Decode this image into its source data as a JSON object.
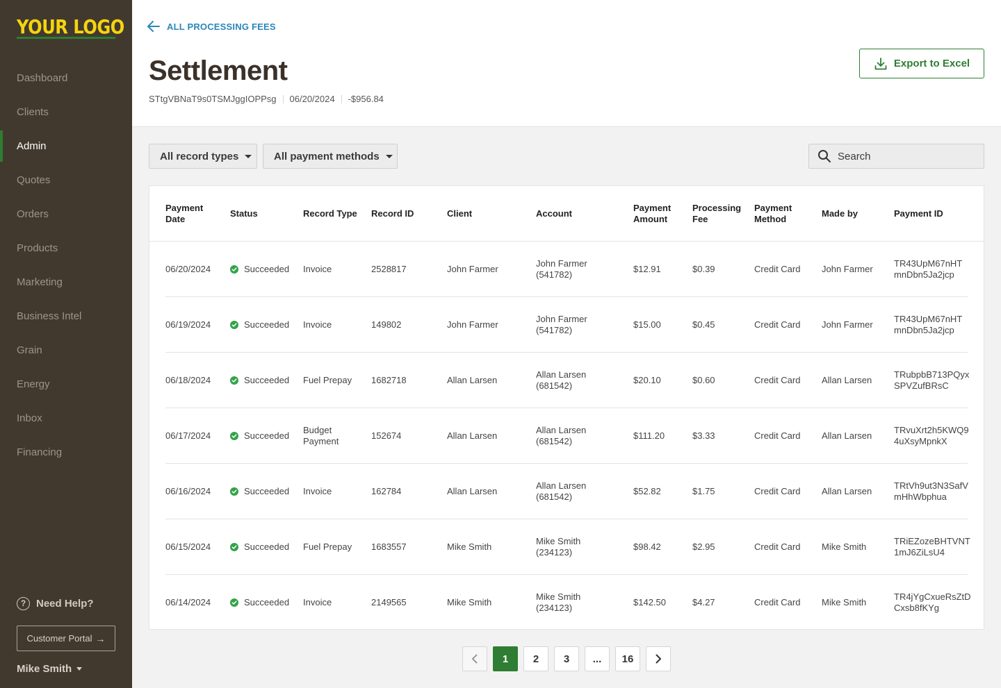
{
  "brand": {
    "logo_text": "YOUR LOGO",
    "accent": "#2e7d32",
    "logo_color": "#f5d40f",
    "sidebar_bg": "#42392e"
  },
  "sidebar": {
    "items": [
      {
        "label": "Dashboard",
        "active": false
      },
      {
        "label": "Clients",
        "active": false
      },
      {
        "label": "Admin",
        "active": true
      },
      {
        "label": "Quotes",
        "active": false
      },
      {
        "label": "Orders",
        "active": false
      },
      {
        "label": "Products",
        "active": false
      },
      {
        "label": "Marketing",
        "active": false
      },
      {
        "label": "Business Intel",
        "active": false
      },
      {
        "label": "Grain",
        "active": false
      },
      {
        "label": "Energy",
        "active": false
      },
      {
        "label": "Inbox",
        "active": false
      },
      {
        "label": "Financing",
        "active": false
      }
    ],
    "help_label": "Need Help?",
    "portal_label": "Customer Portal",
    "user_name": "Mike Smith"
  },
  "header": {
    "back_label": "ALL PROCESSING FEES",
    "title": "Settlement",
    "settlement_id": "STtgVBNaT9s0TSMJggIOPPsg",
    "date": "06/20/2024",
    "amount": "-$956.84",
    "export_label": "Export to Excel"
  },
  "filters": {
    "record_types": "All record types",
    "payment_methods": "All payment methods",
    "search_placeholder": "Search"
  },
  "table": {
    "columns": [
      "Payment Date",
      "Status",
      "Record Type",
      "Record ID",
      "Client",
      "Account",
      "Payment Amount",
      "Processing Fee",
      "Payment Method",
      "Made by",
      "Payment ID"
    ],
    "rows": [
      {
        "date": "06/20/2024",
        "status": "Succeeded",
        "record_type": "Invoice",
        "record_id": "2528817",
        "client": "John Farmer",
        "account": "John Farmer\n(541782)",
        "amount": "$12.91",
        "fee": "$0.39",
        "method": "Credit Card",
        "made_by": "John Farmer",
        "payment_id": "TR43UpM67nHT\nmnDbn5Ja2jcp"
      },
      {
        "date": "06/19/2024",
        "status": "Succeeded",
        "record_type": "Invoice",
        "record_id": "149802",
        "client": "John Farmer",
        "account": "John Farmer\n(541782)",
        "amount": "$15.00",
        "fee": "$0.45",
        "method": "Credit Card",
        "made_by": "John Farmer",
        "payment_id": "TR43UpM67nHT\nmnDbn5Ja2jcp"
      },
      {
        "date": "06/18/2024",
        "status": "Succeeded",
        "record_type": "Fuel Prepay",
        "record_id": "1682718",
        "client": "Allan Larsen",
        "account": "Allan Larsen\n(681542)",
        "amount": "$20.10",
        "fee": "$0.60",
        "method": "Credit Card",
        "made_by": "Allan Larsen",
        "payment_id": "TRubpbB713PQyx\nSPVZufBRsC"
      },
      {
        "date": "06/17/2024",
        "status": "Succeeded",
        "record_type": "Budget\nPayment",
        "record_id": "152674",
        "client": "Allan Larsen",
        "account": "Allan Larsen\n(681542)",
        "amount": "$111.20",
        "fee": "$3.33",
        "method": "Credit Card",
        "made_by": "Allan Larsen",
        "payment_id": "TRvuXrt2h5KWQ9\n4uXsyMpnkX"
      },
      {
        "date": "06/16/2024",
        "status": "Succeeded",
        "record_type": "Invoice",
        "record_id": "162784",
        "client": "Allan Larsen",
        "account": "Allan Larsen\n(681542)",
        "amount": "$52.82",
        "fee": "$1.75",
        "method": "Credit Card",
        "made_by": "Allan Larsen",
        "payment_id": "TRtVh9ut3N3SafV\nmHhWbphua"
      },
      {
        "date": "06/15/2024",
        "status": "Succeeded",
        "record_type": "Fuel Prepay",
        "record_id": "1683557",
        "client": "Mike Smith",
        "account": "Mike Smith\n(234123)",
        "amount": "$98.42",
        "fee": "$2.95",
        "method": "Credit Card",
        "made_by": "Mike Smith",
        "payment_id": "TRiEZozeBHTVNT\n1mJ6ZiLsU4"
      },
      {
        "date": "06/14/2024",
        "status": "Succeeded",
        "record_type": "Invoice",
        "record_id": "2149565",
        "client": "Mike Smith",
        "account": "Mike Smith\n(234123)",
        "amount": "$142.50",
        "fee": "$4.27",
        "method": "Credit Card",
        "made_by": "Mike Smith",
        "payment_id": "TR4jYgCxueRsZtD\nCxsb8fKYg"
      }
    ]
  },
  "pagination": {
    "pages": [
      "1",
      "2",
      "3",
      "...",
      "16"
    ],
    "current": "1"
  },
  "icons": {
    "back": "arrow-left-icon",
    "export": "download-icon",
    "search": "search-icon",
    "help": "question-circle-icon",
    "portal": "arrow-right-icon",
    "status": "check-circle-icon"
  }
}
